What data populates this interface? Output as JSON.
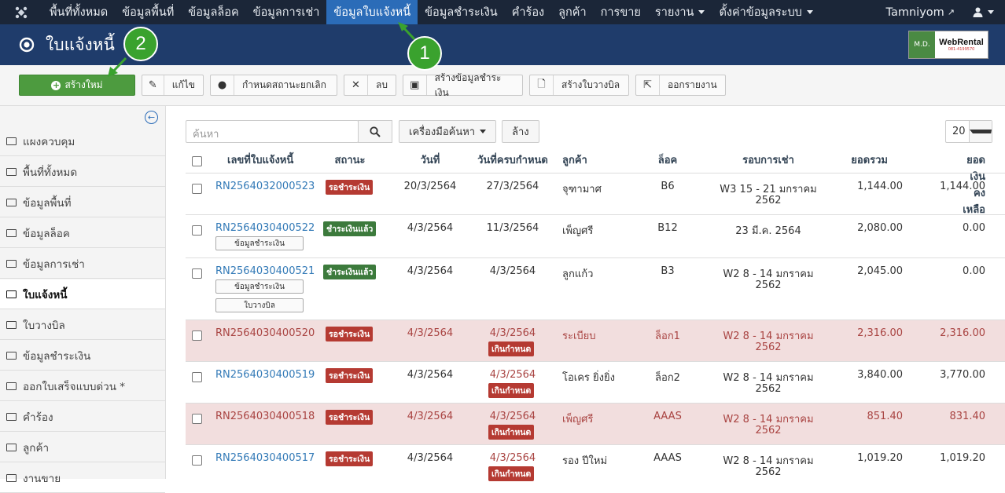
{
  "nav": {
    "items": [
      "พื้นที่ทั้งหมด",
      "ข้อมูลพื้นที่",
      "ข้อมูลล็อค",
      "ข้อมูลการเช่า",
      "ข้อมูลใบแจ้งหนี้",
      "ข้อมูลชำระเงิน",
      "คำร้อง",
      "ลูกค้า",
      "การขาย",
      "รายงาน",
      "ตั้งค่าข้อมูลระบบ"
    ],
    "user": "Tamniyom"
  },
  "header": {
    "title": "ใบแจ้งหนี้",
    "brand_left": "M.D.",
    "brand_name": "WebRental",
    "brand_phone": "081-4199570"
  },
  "toolbar": {
    "create": "สร้างใหม่",
    "edit": "แก้ไข",
    "set_status": "กำหนดสถานะยกเลิก",
    "delete": "ลบ",
    "create_payment": "สร้างข้อมูลชำระเงิน",
    "create_bill": "สร้างใบวางบิล",
    "export": "ออกรายงาน"
  },
  "sidebar": {
    "items": [
      "แผงควบคุม",
      "พื้นที่ทั้งหมด",
      "ข้อมูลพื้นที่",
      "ข้อมูลล็อค",
      "ข้อมูลการเช่า",
      "ใบแจ้งหนี้",
      "ใบวางบิล",
      "ข้อมูลชำระเงิน",
      "ออกใบเสร็จแบบด่วน *",
      "คำร้อง",
      "ลูกค้า",
      "งานขาย"
    ]
  },
  "filter": {
    "search_placeholder": "ค้นหา",
    "tools": "เครื่องมือค้นหา",
    "clear": "ล้าง",
    "page_size": "20"
  },
  "table": {
    "headers": [
      "เลขที่ใบแจ้งหนี้",
      "สถานะ",
      "วันที่",
      "วันที่ครบกำหนด",
      "ลูกค้า",
      "ล็อค",
      "รอบการเช่า",
      "ยอดรวม",
      "ยอดเงินคงเหลือ"
    ],
    "rows": [
      {
        "no": "RN2564032000523",
        "status": "รอชำระเงิน",
        "date": "20/3/2564",
        "due": "27/3/2564",
        "overdue": "",
        "customer": "จุฑามาศ",
        "lock": "B6",
        "period1": "W3 15 - 21 มกราคม",
        "period2": "2562",
        "total": "1,144.00",
        "balance": "1,144.00"
      },
      {
        "no": "RN2564030400522",
        "status": "ชำระเงินแล้ว",
        "date": "4/3/2564",
        "due": "11/3/2564",
        "overdue": "",
        "customer": "เพ็ญศรี",
        "lock": "B12",
        "period1": "23 มี.ค. 2564",
        "period2": "",
        "total": "2,080.00",
        "balance": "0.00"
      },
      {
        "no": "RN2564030400521",
        "status": "ชำระเงินแล้ว",
        "date": "4/3/2564",
        "due": "4/3/2564",
        "overdue": "",
        "customer": "ลูกแก้ว",
        "lock": "B3",
        "period1": "W2 8 - 14 มกราคม",
        "period2": "2562",
        "total": "2,045.00",
        "balance": "0.00"
      },
      {
        "no": "RN2564030400520",
        "status": "รอชำระเงิน",
        "date": "4/3/2564",
        "due": "4/3/2564",
        "overdue": "เกินกำหนด",
        "customer": "ระเบียบ",
        "lock": "ล็อก1",
        "period1": "W2 8 - 14 มกราคม",
        "period2": "2562",
        "total": "2,316.00",
        "balance": "2,316.00"
      },
      {
        "no": "RN2564030400519",
        "status": "รอชำระเงิน",
        "date": "4/3/2564",
        "due": "4/3/2564",
        "overdue": "เกินกำหนด",
        "customer": "โอเคร ยิ่งยิ่ง",
        "lock": "ล็อก2",
        "period1": "W2 8 - 14 มกราคม",
        "period2": "2562",
        "total": "3,840.00",
        "balance": "3,770.00"
      },
      {
        "no": "RN2564030400518",
        "status": "รอชำระเงิน",
        "date": "4/3/2564",
        "due": "4/3/2564",
        "overdue": "เกินกำหนด",
        "customer": "เพ็ญศรี",
        "lock": "AAAS",
        "period1": "W2 8 - 14 มกราคม",
        "period2": "2562",
        "total": "851.40",
        "balance": "831.40"
      },
      {
        "no": "RN2564030400517",
        "status": "รอชำระเงิน",
        "date": "4/3/2564",
        "due": "4/3/2564",
        "overdue": "เกินกำหนด",
        "customer": "รอง ปีใหม่",
        "lock": "AAAS",
        "period1": "W2 8 - 14 มกราคม",
        "period2": "2562",
        "total": "1,019.20",
        "balance": "1,019.20"
      }
    ],
    "row_btn_payment": "ข้อมูลชำระเงิน",
    "row_btn_bill": "ใบวางบิล"
  },
  "callouts": [
    "1",
    "2"
  ]
}
